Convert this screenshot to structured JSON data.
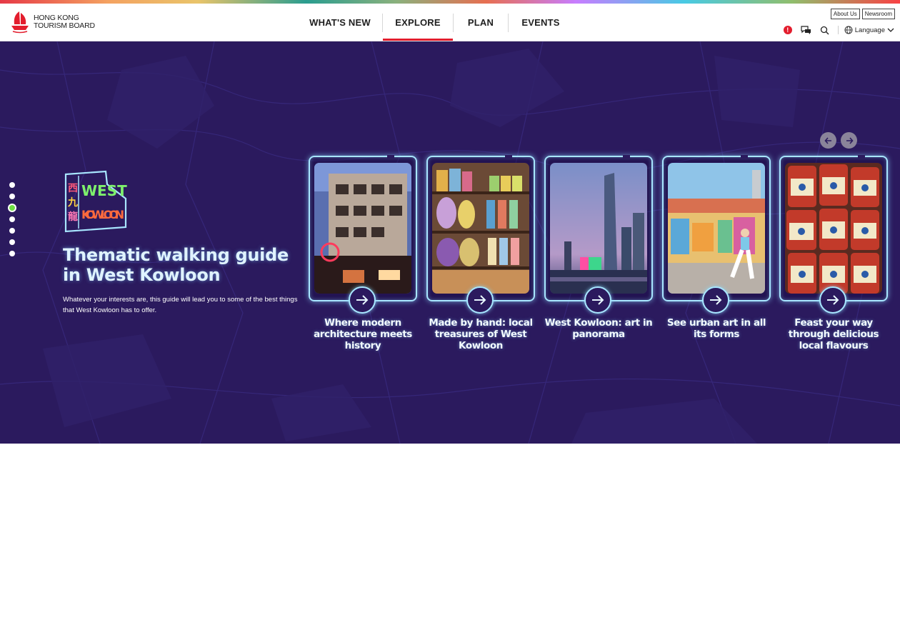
{
  "brand": {
    "line1": "HONG KONG",
    "line2": "TOURISM BOARD",
    "accent": "#e31d2d"
  },
  "nav": {
    "items": [
      {
        "label": "WHAT'S NEW"
      },
      {
        "label": "EXPLORE",
        "active": true
      },
      {
        "label": "PLAN"
      },
      {
        "label": "EVENTS"
      }
    ]
  },
  "utility": {
    "about": "About Us",
    "newsroom": "Newsroom",
    "alert": "!",
    "language": "Language",
    "icons": [
      "alert-icon",
      "chat-icon",
      "search-icon",
      "globe-icon",
      "chevron-down-icon"
    ]
  },
  "hero": {
    "title": "Thematic walking guide in West Kowloon",
    "description": "Whatever your interests are, this guide will lead you to some of the best things that West Kowloon has to offer.",
    "logo": {
      "chinese": "西九龍",
      "english_top": "WEST",
      "english_bottom": "KOWLOON"
    },
    "background": "#2b1a5e",
    "slide_dots": {
      "count": 7,
      "active_index": 2
    },
    "cards": [
      {
        "title": "Where modern architecture meets history"
      },
      {
        "title": "Made by hand: local treasures of West Kowloon"
      },
      {
        "title": "West Kowloon: art in panorama"
      },
      {
        "title": "See urban art in all its forms"
      },
      {
        "title": "Feast your way through delicious local flavours"
      }
    ]
  }
}
